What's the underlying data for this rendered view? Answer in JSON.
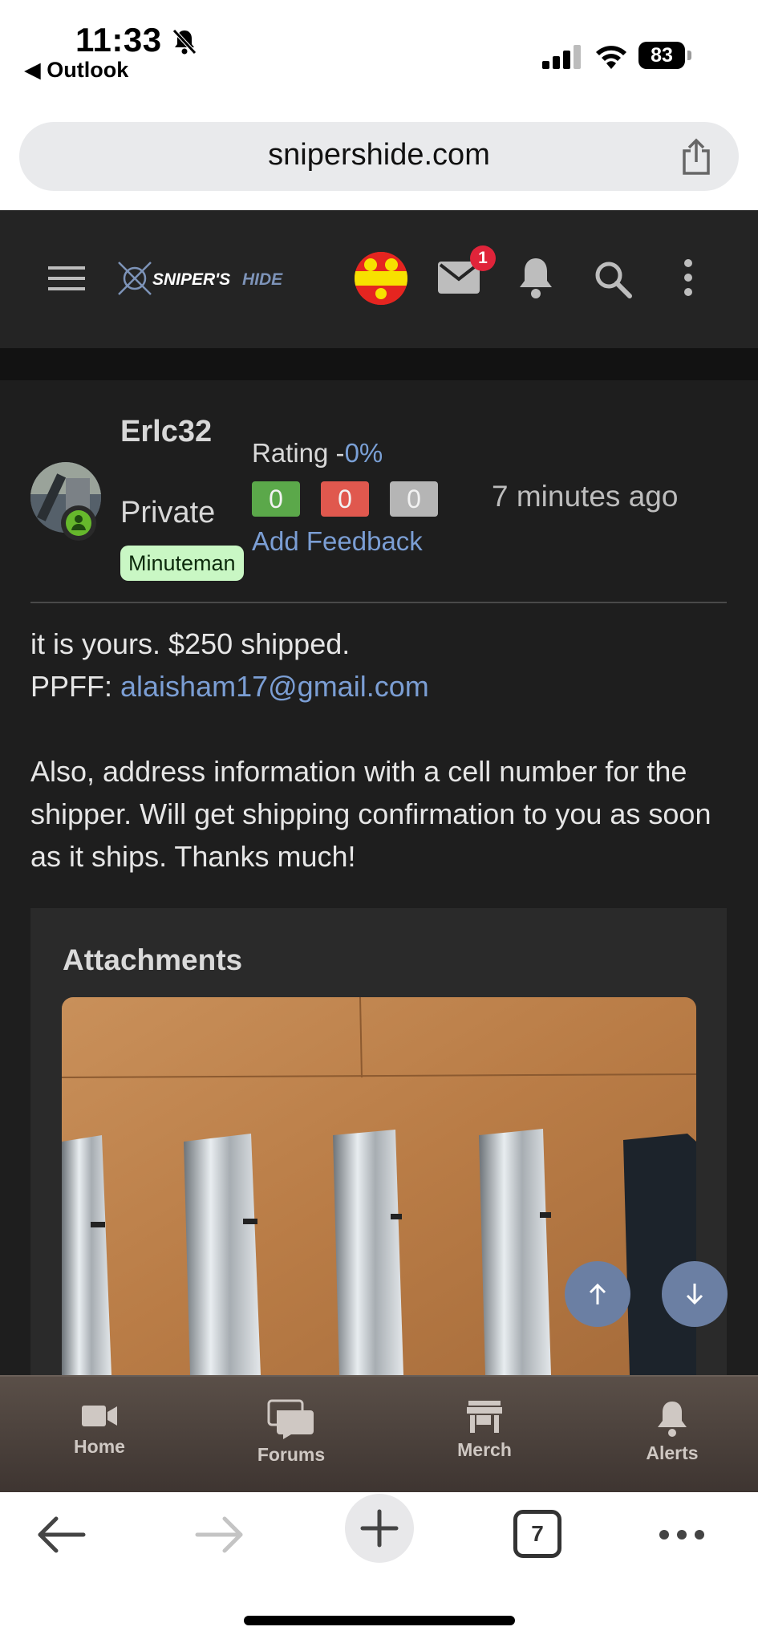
{
  "status_bar": {
    "time": "11:33",
    "back_app": "◀ Outlook",
    "battery": "83"
  },
  "browser": {
    "url": "snipershide.com",
    "tab_count": "7"
  },
  "header": {
    "logo_text": "SNIPER'S HIDE",
    "mail_badge": "1"
  },
  "post": {
    "username": "Erlc32",
    "user_title": "Private",
    "user_badge": "Minuteman",
    "rating_label": "Rating -",
    "rating_value": "0%",
    "positive": "0",
    "negative": "0",
    "neutral": "0",
    "add_feedback": "Add Feedback",
    "timestamp": "7 minutes ago",
    "message_line1": "it is yours. $250 shipped.",
    "message_line2_prefix": "PPFF: ",
    "message_email": "alaisham17@gmail.com",
    "message_para2": "Also, address information with a cell number for the shipper. Will get shipping confirmation to you as soon as it ships. Thanks much!",
    "attachments_title": "Attachments"
  },
  "bottom_nav": {
    "items": [
      {
        "label": "Home",
        "icon": "video-camera-icon"
      },
      {
        "label": "Forums",
        "icon": "chat-bubbles-icon"
      },
      {
        "label": "Merch",
        "icon": "storefront-icon"
      },
      {
        "label": "Alerts",
        "icon": "bell-icon"
      }
    ]
  },
  "colors": {
    "header_bg": "#242424",
    "post_bg": "#1e1e1e",
    "link": "#7b9ed4",
    "positive": "#5ba84a",
    "negative": "#e0584e",
    "neutral": "#b5b5b5",
    "badge_bg": "#c9f7c4"
  }
}
